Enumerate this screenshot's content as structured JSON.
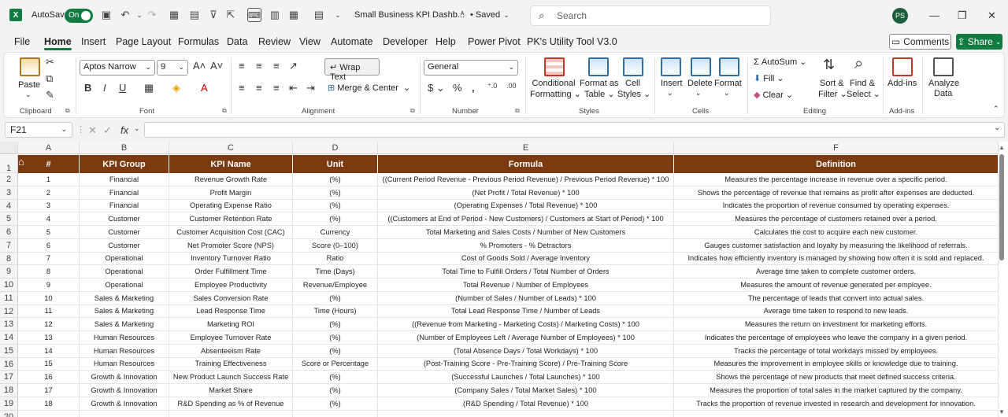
{
  "titlebar": {
    "app_letter": "X",
    "autosave_label": "AutoSave",
    "autosave_state": "On",
    "doc_title": "Small Business KPI Dashb...",
    "saved_status": "• Saved",
    "search_placeholder": "Search",
    "avatar_initials": "PS"
  },
  "menu": {
    "tabs": [
      "File",
      "Home",
      "Insert",
      "Page Layout",
      "Formulas",
      "Data",
      "Review",
      "View",
      "Automate",
      "Developer",
      "Help",
      "Power Pivot",
      "PK's Utility Tool V3.0"
    ],
    "active_tab": "Home",
    "comments_label": "Comments",
    "share_label": "Share"
  },
  "ribbon": {
    "clipboard": {
      "paste": "Paste",
      "label": "Clipboard"
    },
    "font": {
      "name": "Aptos Narrow",
      "size": "9",
      "label": "Font"
    },
    "alignment": {
      "wrap_text": "Wrap Text",
      "merge_center": "Merge & Center",
      "label": "Alignment"
    },
    "number": {
      "format": "General",
      "label": "Number"
    },
    "styles": {
      "conditional": "Conditional",
      "formatting": "Formatting",
      "format_as": "Format as",
      "table": "Table",
      "cell": "Cell",
      "cell_styles": "Styles",
      "label": "Styles"
    },
    "cells": {
      "insert": "Insert",
      "delete": "Delete",
      "format": "Format",
      "label": "Cells"
    },
    "editing": {
      "autosum": "AutoSum",
      "fill": "Fill",
      "clear": "Clear",
      "sort": "Sort &",
      "filter": "Filter",
      "find": "Find &",
      "select": "Select",
      "label": "Editing"
    },
    "addins": {
      "addins": "Add-ins",
      "label": "Add-ins",
      "analyze": "Analyze",
      "data": "Data"
    }
  },
  "formula_bar": {
    "cell_ref": "F21",
    "fx": "fx",
    "value": ""
  },
  "sheet": {
    "columns": [
      "A",
      "B",
      "C",
      "D",
      "E",
      "F"
    ],
    "headers": [
      "#",
      "KPI Group",
      "KPI Name",
      "Unit",
      "Formula",
      "Definition"
    ],
    "rows": [
      [
        "1",
        "Financial",
        "Revenue Growth Rate",
        "(%)",
        "((Current Period Revenue - Previous Period Revenue) / Previous Period Revenue) * 100",
        "Measures the percentage increase in revenue over a specific period."
      ],
      [
        "2",
        "Financial",
        "Profit Margin",
        "(%)",
        "(Net Profit / Total Revenue) * 100",
        "Shows the percentage of revenue that remains as profit after expenses are deducted."
      ],
      [
        "3",
        "Financial",
        "Operating Expense Ratio",
        "(%)",
        "(Operating Expenses / Total Revenue) * 100",
        "Indicates the proportion of revenue consumed by operating expenses."
      ],
      [
        "4",
        "Customer",
        "Customer Retention Rate",
        "(%)",
        "((Customers at End of Period - New Customers) / Customers at Start of Period) * 100",
        "Measures the percentage of customers retained over a period."
      ],
      [
        "5",
        "Customer",
        "Customer Acquisition Cost (CAC)",
        "Currency",
        "Total Marketing and Sales Costs / Number of New Customers",
        "Calculates the cost to acquire each new customer."
      ],
      [
        "6",
        "Customer",
        "Net Promoter Score (NPS)",
        "Score (0–100)",
        "% Promoters - % Detractors",
        "Gauges customer satisfaction and loyalty by measuring the likelihood of referrals."
      ],
      [
        "7",
        "Operational",
        "Inventory Turnover Ratio",
        "Ratio",
        "Cost of Goods Sold / Average Inventory",
        "Indicates how efficiently inventory is managed by showing how often it is sold and replaced."
      ],
      [
        "8",
        "Operational",
        "Order Fulfillment Time",
        "Time (Days)",
        "Total Time to Fulfill Orders / Total Number of Orders",
        "Average time taken to complete customer orders."
      ],
      [
        "9",
        "Operational",
        "Employee Productivity",
        "Revenue/Employee",
        "Total Revenue / Number of Employees",
        "Measures the amount of revenue generated per employee."
      ],
      [
        "10",
        "Sales & Marketing",
        "Sales Conversion Rate",
        "(%)",
        "(Number of Sales / Number of Leads) * 100",
        "The percentage of leads that convert into actual sales."
      ],
      [
        "11",
        "Sales & Marketing",
        "Lead Response Time",
        "Time (Hours)",
        "Total Lead Response Time / Number of Leads",
        "Average time taken to respond to new leads."
      ],
      [
        "12",
        "Sales & Marketing",
        "Marketing ROI",
        "(%)",
        "((Revenue from Marketing - Marketing Costs) / Marketing Costs) * 100",
        "Measures the return on investment for marketing efforts."
      ],
      [
        "13",
        "Human Resources",
        "Employee Turnover Rate",
        "(%)",
        "(Number of Employees Left / Average Number of Employees) * 100",
        "Indicates the percentage of employees who leave the company in a given period."
      ],
      [
        "14",
        "Human Resources",
        "Absenteeism Rate",
        "(%)",
        "(Total Absence Days / Total Workdays) * 100",
        "Tracks the percentage of total workdays missed by employees."
      ],
      [
        "15",
        "Human Resources",
        "Training Effectiveness",
        "Score or Percentage",
        "(Post-Training Score - Pre-Training Score) / Pre-Training Score",
        "Measures the improvement in employee skills or knowledge due to training."
      ],
      [
        "16",
        "Growth & Innovation",
        "New Product Launch Success Rate",
        "(%)",
        "(Successful Launches / Total Launches) * 100",
        "Shows the percentage of new products that meet defined success criteria."
      ],
      [
        "17",
        "Growth & Innovation",
        "Market Share",
        "(%)",
        "(Company Sales / Total Market Sales) * 100",
        "Measures the proportion of total sales in the market captured by the company."
      ],
      [
        "18",
        "Growth & Innovation",
        "R&D Spending as % of Revenue",
        "(%)",
        "(R&D Spending / Total Revenue) * 100",
        "Tracks the proportion of revenue invested in research and development for innovation."
      ]
    ]
  },
  "colors": {
    "excel_green": "#107c41",
    "header_brown": "#7b3a10"
  }
}
